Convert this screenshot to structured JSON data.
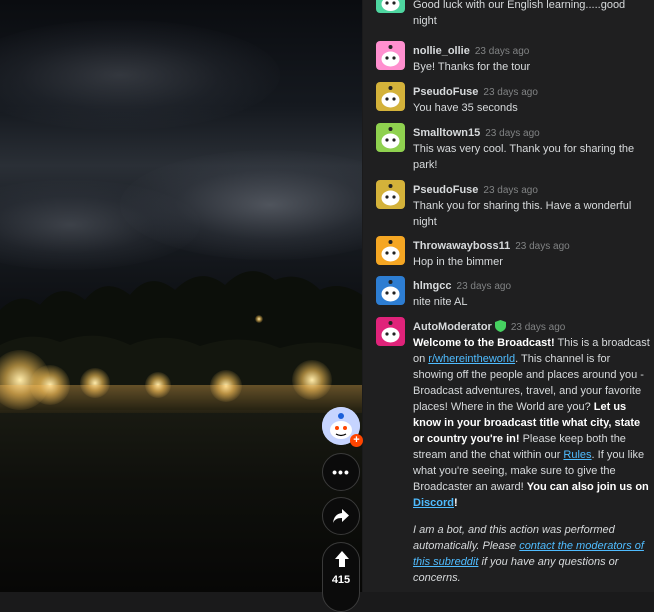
{
  "stream": {
    "upvote_count": "415"
  },
  "chat": {
    "partial_message": {
      "text": "Good luck with our English learning.....good night",
      "avatar_color": "#4ed6a0"
    },
    "messages": [
      {
        "user": "nollie_ollie",
        "time": "23 days ago",
        "text": "Bye! Thanks for the tour",
        "avatar_color": "#ff8fcf"
      },
      {
        "user": "PseudoFuse",
        "time": "23 days ago",
        "text": "You have 35 seconds",
        "avatar_color": "#d4b23a"
      },
      {
        "user": "Smalltown15",
        "time": "23 days ago",
        "text": "This was very cool. Thank you for sharing the park!",
        "avatar_color": "#8fd14f"
      },
      {
        "user": "PseudoFuse",
        "time": "23 days ago",
        "text": "Thank you for sharing this. Have a wonderful night",
        "avatar_color": "#d4b23a"
      },
      {
        "user": "Throwawayboss11",
        "time": "23 days ago",
        "text": "Hop in the bimmer",
        "avatar_color": "#f5a623"
      },
      {
        "user": "hlmgcc",
        "time": "23 days ago",
        "text": "nite nite AL",
        "avatar_color": "#2d7dd2"
      }
    ],
    "automod": {
      "user": "AutoModerator",
      "time": "23 days ago",
      "avatar_color": "#e0237a",
      "p1_welcome": "Welcome to the Broadcast!",
      "p1_a": " This is a broadcast on ",
      "p1_sub": "r/whereintheworld",
      "p1_b": ". This channel is for showing off the people and places around you - Broadcast adventures, travel, and your favorite places! Where in the World are you? ",
      "p1_bold": "Let us know in your broadcast title what city, state or country you're in!",
      "p1_c": " Please keep both the stream and the chat within our ",
      "p1_rules": "Rules",
      "p1_d": ". If you like what you're seeing, make sure to give the Broadcaster an award! ",
      "p1_join": "You can also join us on ",
      "p1_discord": "Discord",
      "p1_end": "!",
      "p2_a": "I am a bot, and this action was performed automatically. Please ",
      "p2_link": "contact the moderators of this subreddit",
      "p2_b": " if you have any questions or concerns."
    }
  }
}
